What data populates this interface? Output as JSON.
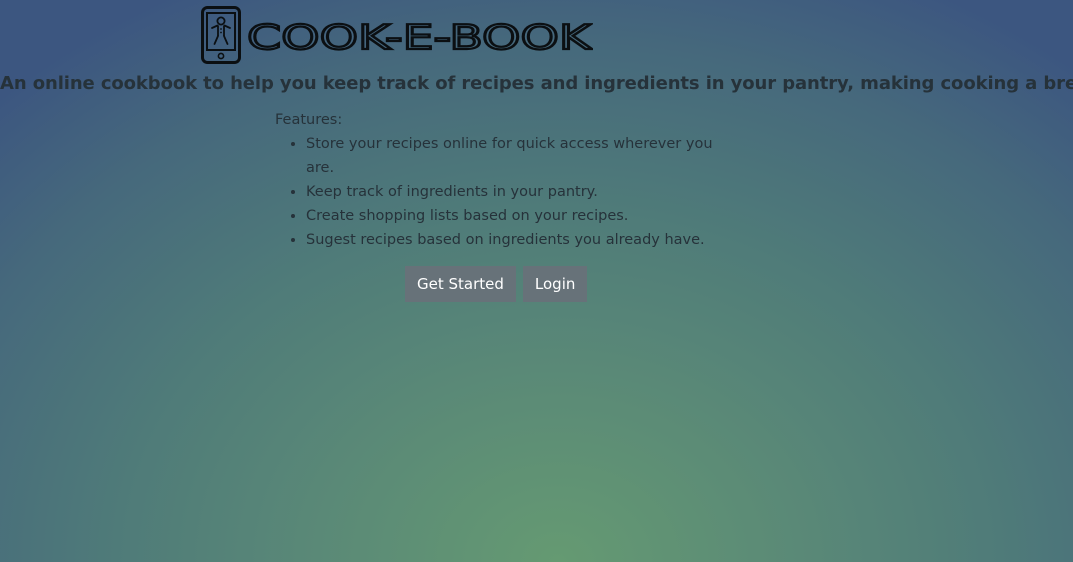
{
  "logo": {
    "icon": "ebook-reader-gingerbread-icon",
    "wordmark": "COOK-E-BOOK"
  },
  "tagline": "An online cookbook to help you keep track of recipes and ingredients in your pantry, making cooking a breeze.",
  "features": {
    "heading": "Features:",
    "items": [
      "Store your recipes online for quick access wherever you are.",
      "Keep track of ingredients in your pantry.",
      "Create shopping lists based on your recipes.",
      "Sugest recipes based on ingredients you already have."
    ]
  },
  "buttons": {
    "get_started": "Get Started",
    "login": "Login"
  },
  "colors": {
    "button_bg": "#677279",
    "text": "#26323a",
    "bg_center": "#659a72",
    "bg_edge": "#3c5680"
  }
}
